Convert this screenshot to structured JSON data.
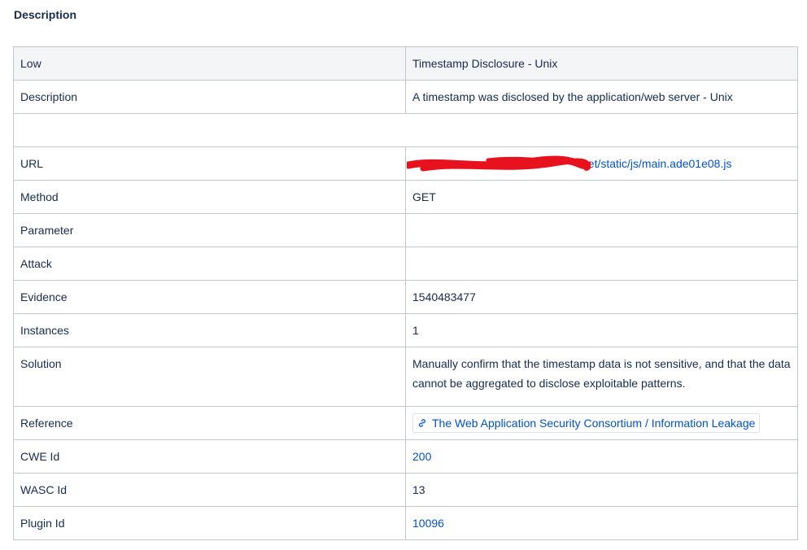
{
  "section": {
    "title": "Description"
  },
  "alert": {
    "risk": "Low",
    "name": "Timestamp Disclosure - Unix",
    "rows": [
      {
        "label": "Description",
        "value": "A timestamp was disclosed by the application/web server - Unix"
      },
      {
        "label": "URL",
        "value": "net/static/js/main.ade01e08.js"
      },
      {
        "label": "Method",
        "value": "GET"
      },
      {
        "label": "Parameter",
        "value": ""
      },
      {
        "label": "Attack",
        "value": ""
      },
      {
        "label": "Evidence",
        "value": "1540483477"
      },
      {
        "label": "Instances",
        "value": "1"
      },
      {
        "label": "Solution",
        "value": "Manually confirm that the timestamp data is not sensitive, and that the data cannot be aggregated to disclose exploitable patterns."
      },
      {
        "label": "Reference",
        "value": "The Web Application Security Consortium / Information Leakage"
      },
      {
        "label": "CWE Id",
        "value": "200"
      },
      {
        "label": "WASC Id",
        "value": "13"
      },
      {
        "label": "Plugin Id",
        "value": "10096"
      }
    ]
  },
  "icons": {
    "reference": "link-icon",
    "redaction": "redaction-scribble"
  },
  "colors": {
    "link": "#0052cc",
    "redaction": "#e8121f",
    "header_bg": "#f4f5f7",
    "border": "#c1c7d0",
    "text": "#172b4d"
  }
}
